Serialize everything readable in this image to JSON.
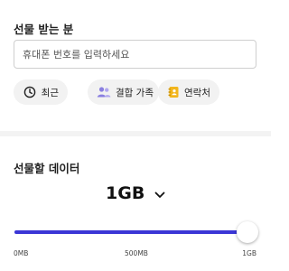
{
  "recipient": {
    "title": "선물 받는 분",
    "phone_placeholder": "휴대폰 번호를 입력하세요",
    "phone_value": ""
  },
  "quick_select": [
    {
      "label": "최근",
      "icon": "clock-icon"
    },
    {
      "label": "결합 가족",
      "icon": "people-icon"
    },
    {
      "label": "연락처",
      "icon": "contacts-book-icon"
    }
  ],
  "data_gift": {
    "title": "선물할 데이터",
    "selected_amount": "1GB",
    "slider": {
      "min_label": "0MB",
      "mid_label": "500MB",
      "max_label": "1GB",
      "value_fraction": 1.0
    }
  },
  "colors": {
    "accent": "#3b36d6",
    "people_icon": "#8a7fe0",
    "contacts_icon": "#f2b51c"
  }
}
